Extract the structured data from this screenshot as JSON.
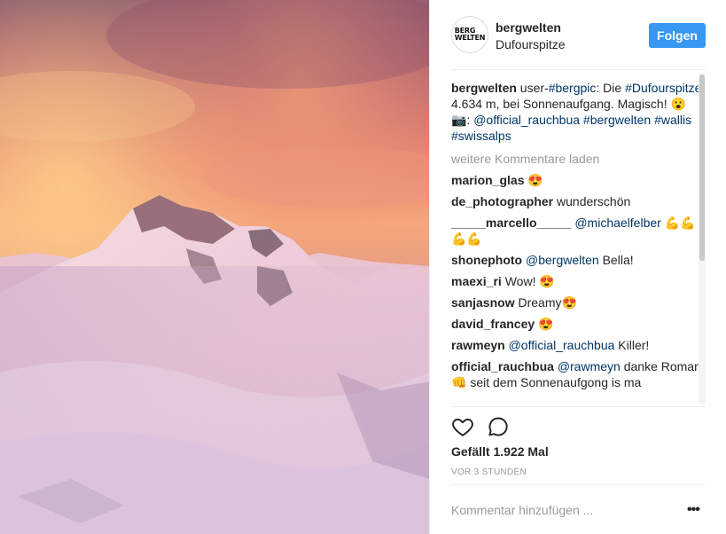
{
  "header": {
    "avatar_logo_line1": "BERG",
    "avatar_logo_line2": "WELTEN",
    "username": "bergwelten",
    "location": "Dufourspitze",
    "follow_label": "Folgen"
  },
  "caption": {
    "username": "bergwelten",
    "text_1": " user-",
    "tag_1": "#bergpic",
    "text_2": ": Die ",
    "tag_2": "#Dufourspitze",
    "text_3": ", 4.634 m, bei Sonnenaufgang. Magisch! 😮 📷: ",
    "tag_3": "@official_rauchbua",
    "tag_4": "#bergwelten",
    "tag_5": "#wallis",
    "tag_6": "#swissalps"
  },
  "load_more": "weitere Kommentare laden",
  "comments": [
    {
      "user": "marion_glas",
      "text": " 😍"
    },
    {
      "user": "de_photographer",
      "text": " wunderschön"
    },
    {
      "user": "_____marcello_____",
      "mention": "@michaelfelber",
      "text": " 💪💪💪💪"
    },
    {
      "user": "shonephoto",
      "mention": "@bergwelten",
      "text": " Bella!"
    },
    {
      "user": "maexi_ri",
      "text": " Wow! 😍"
    },
    {
      "user": "sanjasnow",
      "text": " Dreamy😍"
    },
    {
      "user": "david_francey",
      "text": " 😍"
    },
    {
      "user": "rawmeyn",
      "mention": "@official_rauchbua",
      "text": " Killer!"
    },
    {
      "user": "official_rauchbua",
      "mention": "@rawmeyn",
      "text": " danke Roman 👊 seit dem Sonnenaufgong is ma"
    }
  ],
  "likes": "Gefällt 1.922 Mal",
  "timestamp": "VOR 3 STUNDEN",
  "add_comment_placeholder": "Kommentar hinzufügen ...",
  "more_options": "•••",
  "icons": {
    "like": "heart-outline-icon",
    "comment": "speech-bubble-icon",
    "more": "ellipsis-icon"
  },
  "colors": {
    "follow_button": "#3897f0",
    "link": "#003569",
    "muted": "#999999"
  }
}
